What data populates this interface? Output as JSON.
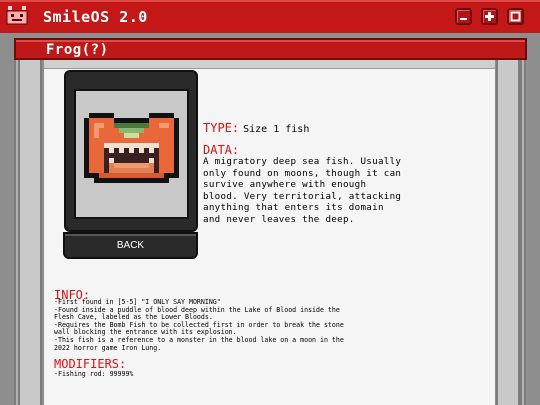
{
  "app": {
    "title": "SmileOS 2.0",
    "logo_icon": "smiley-robot-icon",
    "window_buttons": [
      "minimize-icon",
      "plus-icon",
      "maximize-icon"
    ]
  },
  "page": {
    "title": "Frog(?)"
  },
  "card": {
    "image_icon": "pixel-frog-fish-icon",
    "back_label": "BACK"
  },
  "entry": {
    "type_label": "TYPE:",
    "type_value": "Size 1 fish",
    "data_label": "DATA:",
    "data_lines": [
      "A migratory deep sea fish. Usually",
      "only found on moons, though it can",
      "survive anywhere with enough",
      "blood. Very territorial, attacking",
      "anything that enters its domain",
      "and never leaves the deep."
    ],
    "info_label": "INFO:",
    "info_lines": [
      "-First found in [5-5] \"I ONLY SAY MORNING\"",
      "-Found inside a puddle of blood deep within the Lake of Blood inside the",
      "Flesh Cave, labeled as the Lower Bloods.",
      "-Requires the Bomb Fish to be collected first in order to break the stone",
      "wall blocking the entrance with its explosion.",
      "-This fish is a reference to a monster in the blood lake on a moon in the",
      "2022 horror game Iron Lung."
    ],
    "modifiers_label": "MODIFIERS:",
    "modifier_lines": [
      "-Fishing rod: 99999%"
    ]
  },
  "colors": {
    "accent_red": "#c41818",
    "label_red": "#e01010",
    "panel_bg": "#f5f5f5",
    "frame_gray": "#a9a9a9"
  }
}
